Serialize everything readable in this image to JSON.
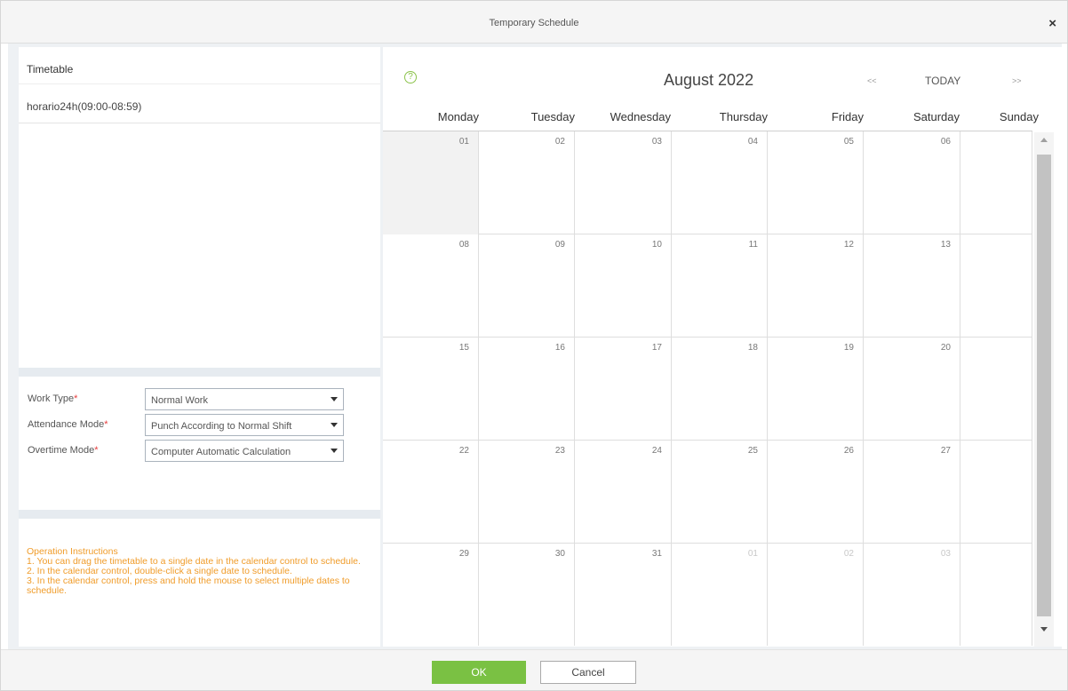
{
  "dialog": {
    "title": "Temporary Schedule",
    "close_label": "×"
  },
  "timetable": {
    "header": "Timetable",
    "items": [
      "horario24h(09:00-08:59)"
    ]
  },
  "form": {
    "work_type": {
      "label": "Work Type",
      "value": "Normal Work"
    },
    "attendance_mode": {
      "label": "Attendance Mode",
      "value": "Punch According to Normal Shift"
    },
    "overtime_mode": {
      "label": "Overtime Mode",
      "value": "Computer Automatic Calculation"
    },
    "required_mark": "*"
  },
  "instructions": {
    "heading": "Operation Instructions",
    "lines": [
      "1. You can drag the timetable to a single date in the calendar control to schedule.",
      "2. In the calendar control, double-click a single date to schedule.",
      "3. In the calendar control, press and hold the mouse to select multiple dates to schedule."
    ]
  },
  "calendar": {
    "help_icon": "?",
    "month_title": "August 2022",
    "prev_label": "<<",
    "today_label": "TODAY",
    "next_label": ">>",
    "weekdays": [
      "Monday",
      "Tuesday",
      "Wednesday",
      "Thursday",
      "Friday",
      "Saturday",
      "Sunday"
    ],
    "weeks": [
      [
        "01",
        "02",
        "03",
        "04",
        "05",
        "06",
        ""
      ],
      [
        "08",
        "09",
        "10",
        "11",
        "12",
        "13",
        ""
      ],
      [
        "15",
        "16",
        "17",
        "18",
        "19",
        "20",
        ""
      ],
      [
        "22",
        "23",
        "24",
        "25",
        "26",
        "27",
        ""
      ],
      [
        "29",
        "30",
        "31",
        "01",
        "02",
        "03",
        ""
      ]
    ],
    "other_month": [
      [
        4,
        3
      ],
      [
        4,
        4
      ],
      [
        4,
        5
      ]
    ],
    "selected": [
      0,
      0
    ]
  },
  "footer": {
    "ok_label": "OK",
    "cancel_label": "Cancel"
  },
  "colors": {
    "accent_green": "#7ac143",
    "instruction_orange": "#f09c2a",
    "required_red": "#e63c3c"
  }
}
